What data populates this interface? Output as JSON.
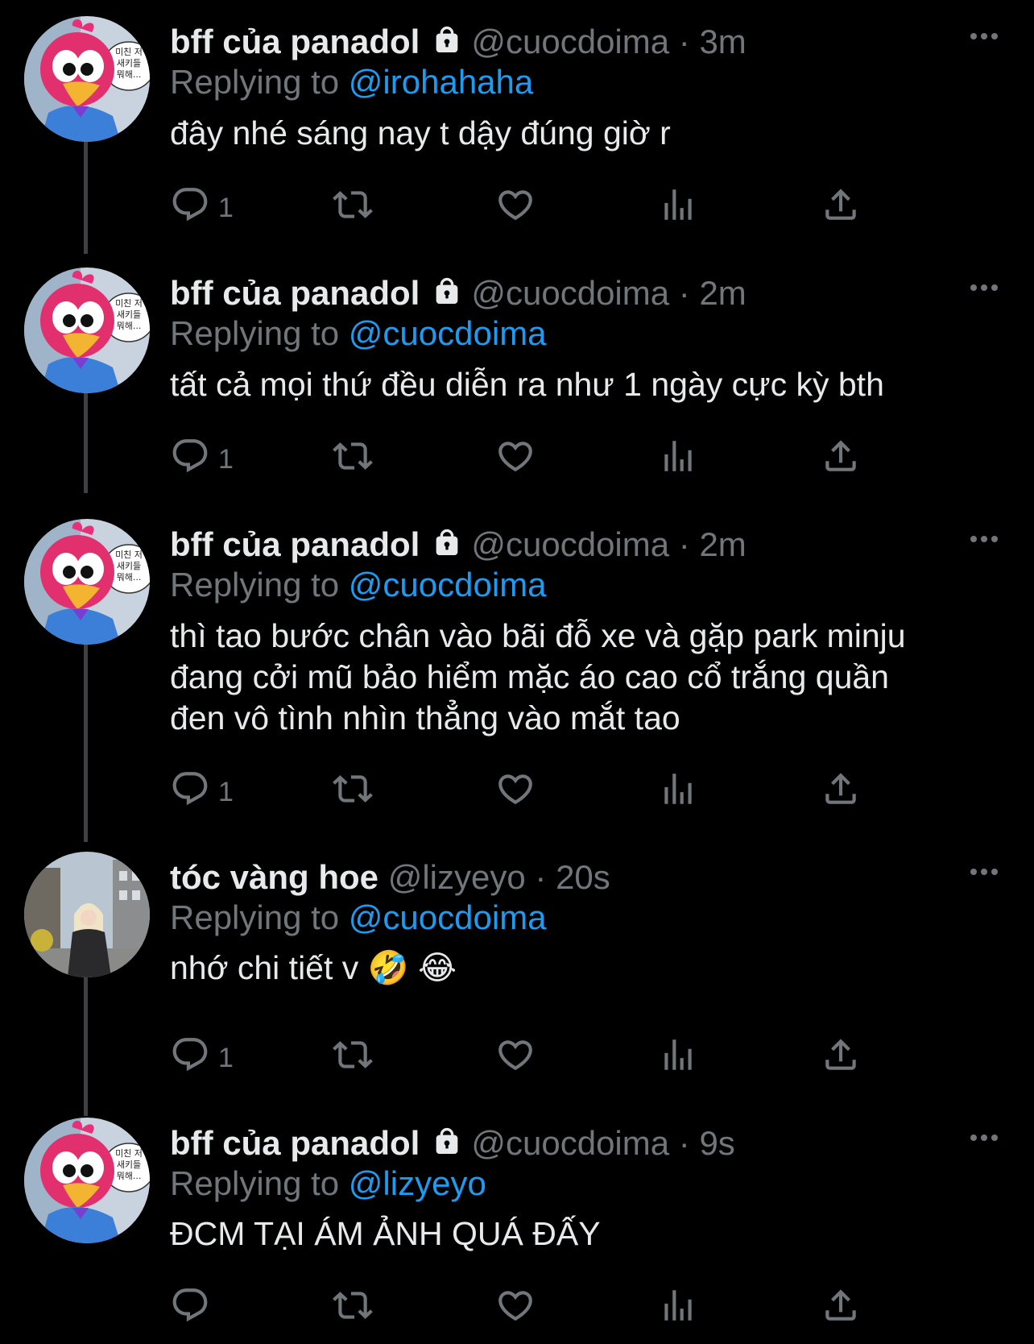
{
  "colors": {
    "background": "#000000",
    "text": "#e7e9ea",
    "muted": "#71767b",
    "link": "#1d9bf0",
    "thread": "#3e4144"
  },
  "tweets": [
    {
      "name": "bff của panadol",
      "protected": true,
      "handle": "@cuocdoima",
      "separator": "·",
      "time": "3m",
      "replying_prefix": "Replying to",
      "replying_to": "@irohahaha",
      "lines": [
        "đây nhé sáng nay t dậy đúng giờ r"
      ],
      "reply_count": "1",
      "avatar": "parrot-avatar"
    },
    {
      "name": "bff của panadol",
      "protected": true,
      "handle": "@cuocdoima",
      "separator": "·",
      "time": "2m",
      "replying_prefix": "Replying to",
      "replying_to": "@cuocdoima",
      "lines": [
        "tất cả mọi thứ đều diễn ra như 1 ngày cực kỳ bth"
      ],
      "reply_count": "1",
      "avatar": "parrot-avatar"
    },
    {
      "name": "bff của panadol",
      "protected": true,
      "handle": "@cuocdoima",
      "separator": "·",
      "time": "2m",
      "replying_prefix": "Replying to",
      "replying_to": "@cuocdoima",
      "lines": [
        "thì tao bước chân vào bãi đỗ xe và gặp park minju",
        "đang cởi mũ bảo hiểm mặc áo cao cổ trắng quần",
        "đen vô tình nhìn thẳng vào mắt tao"
      ],
      "reply_count": "1",
      "avatar": "parrot-avatar"
    },
    {
      "name": "tóc vàng hoe",
      "protected": false,
      "handle": "@lizyeyo",
      "separator": "·",
      "time": "20s",
      "replying_prefix": "Replying to",
      "replying_to": "@cuocdoima",
      "lines": [
        "nhớ chi tiết v 🤣 😂"
      ],
      "reply_count": "1",
      "avatar": "street-photo-avatar"
    },
    {
      "name": "bff của panadol",
      "protected": true,
      "handle": "@cuocdoima",
      "separator": "·",
      "time": "9s",
      "replying_prefix": "Replying to",
      "replying_to": "@lizyeyo",
      "lines": [
        "ĐCM TẠI ÁM ẢNH QUÁ ĐẤY"
      ],
      "reply_count": "",
      "avatar": "parrot-avatar"
    }
  ],
  "avatar_bubble_text": [
    "미친 저",
    "새키들",
    "뭐해..."
  ]
}
